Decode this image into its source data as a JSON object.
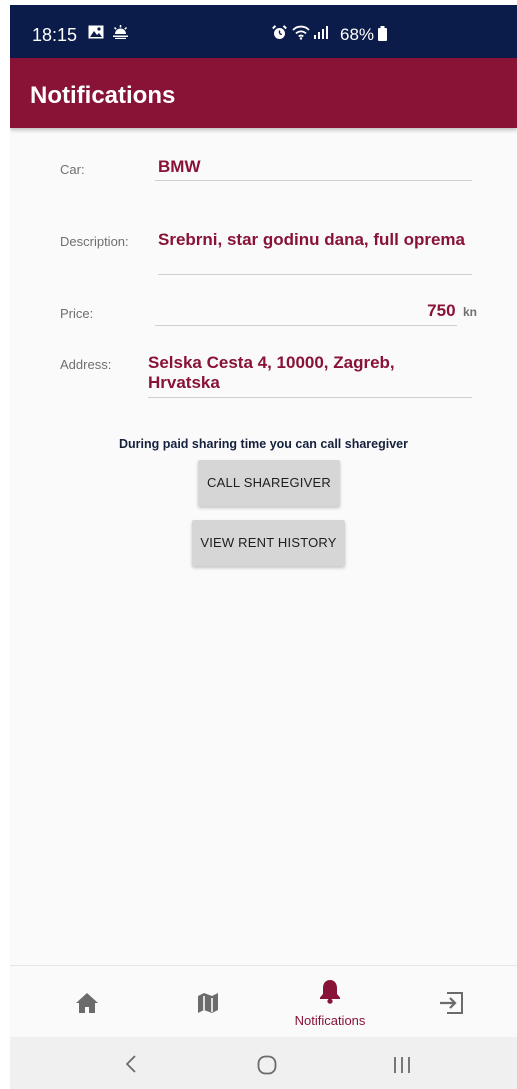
{
  "status_bar": {
    "time": "18:15",
    "battery": "68%"
  },
  "app_bar": {
    "title": "Notifications"
  },
  "form": {
    "car_label": "Car:",
    "car_value": "BMW",
    "description_label": "Description:",
    "description_value": "Srebrni, star godinu dana, full oprema",
    "price_label": "Price:",
    "price_value": "750",
    "price_unit": "kn",
    "address_label": "Address:",
    "address_line1": "Selska Cesta 4, 10000, Zagreb,",
    "address_line2": "Hrvatska"
  },
  "hint_text": "During paid sharing time you can call sharegiver",
  "buttons": {
    "call": "CALL SHAREGIVER",
    "history": "VIEW RENT HISTORY"
  },
  "bottom_nav": {
    "items": [
      {
        "icon": "home-icon",
        "label": ""
      },
      {
        "icon": "map-icon",
        "label": ""
      },
      {
        "icon": "bell-icon",
        "label": "Notifications",
        "active": true
      },
      {
        "icon": "logout-icon",
        "label": ""
      }
    ]
  },
  "colors": {
    "primary": "#881337",
    "status_bar": "#0c1c4a",
    "hint_text": "#14213d"
  }
}
